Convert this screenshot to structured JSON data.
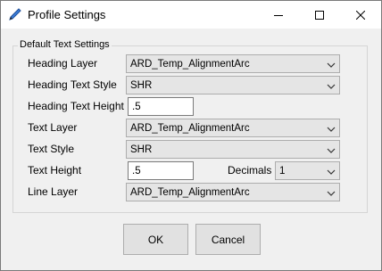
{
  "window": {
    "title": "Profile Settings",
    "app_icon": "pen-drafting-icon"
  },
  "titlebar_buttons": {
    "minimize_icon": "minimize-icon",
    "maximize_icon": "maximize-icon",
    "close_icon": "close-icon"
  },
  "group": {
    "label": "Default Text Settings"
  },
  "fields": {
    "heading_layer": {
      "label": "Heading Layer",
      "value": "ARD_Temp_AlignmentArc"
    },
    "heading_text_style": {
      "label": "Heading Text Style",
      "value": "SHR"
    },
    "heading_text_height": {
      "label": "Heading Text Height",
      "value": ".5"
    },
    "text_layer": {
      "label": "Text Layer",
      "value": "ARD_Temp_AlignmentArc"
    },
    "text_style": {
      "label": "Text Style",
      "value": "SHR"
    },
    "text_height": {
      "label": "Text Height",
      "value": ".5"
    },
    "decimals": {
      "label": "Decimals",
      "value": "1"
    },
    "line_layer": {
      "label": "Line Layer",
      "value": "ARD_Temp_AlignmentArc"
    }
  },
  "buttons": {
    "ok": "OK",
    "cancel": "Cancel"
  }
}
